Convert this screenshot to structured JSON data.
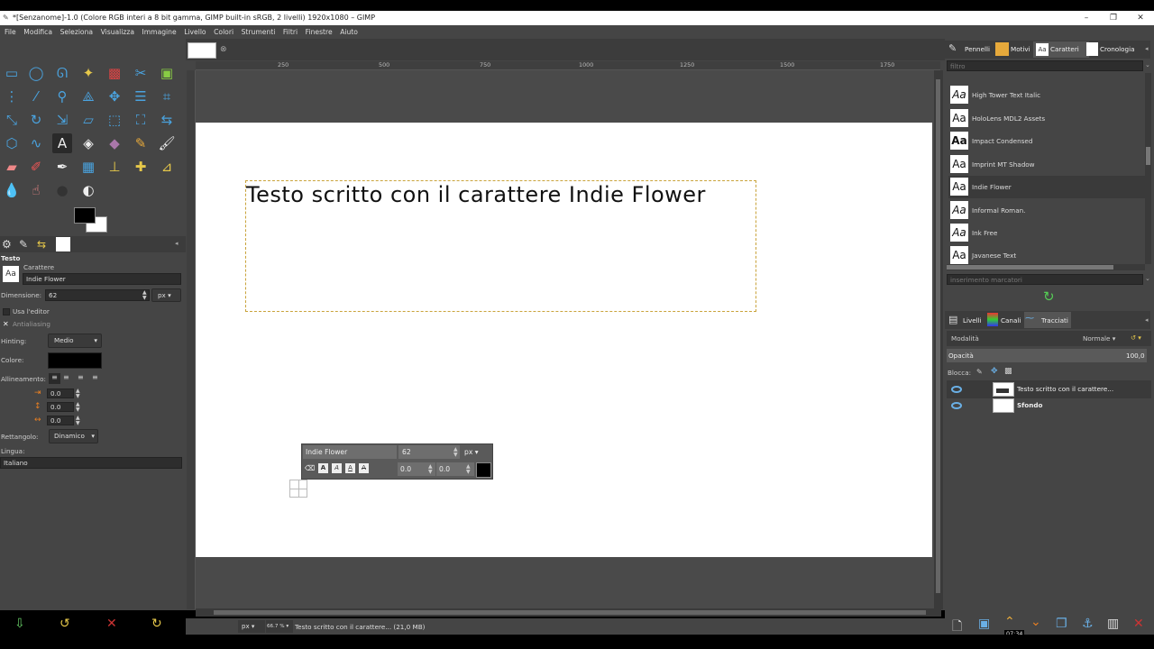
{
  "window": {
    "title": "*[Senzanome]-1.0 (Colore RGB interi a 8 bit gamma, GIMP built-in sRGB, 2 livelli) 1920x1080 – GIMP"
  },
  "menu": [
    "File",
    "Modifica",
    "Seleziona",
    "Visualizza",
    "Immagine",
    "Livello",
    "Colori",
    "Strumenti",
    "Filtri",
    "Finestre",
    "Aiuto"
  ],
  "ruler": {
    "ticks": [
      "250",
      "500",
      "750",
      "1000",
      "1250",
      "1500",
      "1750"
    ]
  },
  "canvas": {
    "text": "Testo scritto con il carattere Indie Flower"
  },
  "tool_options": {
    "title": "Testo",
    "font_label": "Carattere",
    "font_value": "Indie Flower",
    "size_label": "Dimensione:",
    "size_value": "62",
    "size_unit": "px",
    "use_editor": "Usa l'editor",
    "antialiasing": "Antialiasing",
    "hinting_label": "Hinting:",
    "hinting_value": "Medio",
    "color_label": "Colore:",
    "align_label": "Allineamento:",
    "indent_value": "0.0",
    "line_spacing_value": "0.0",
    "letter_spacing_value": "0.0",
    "box_label": "Rettangolo:",
    "box_value": "Dinamico",
    "lang_label": "Lingua:",
    "lang_value": "Italiano"
  },
  "on_canvas_editor": {
    "font": "Indie Flower",
    "size": "62",
    "unit": "px",
    "baseline": "0.0",
    "kerning": "0.0"
  },
  "status": {
    "unit": "px",
    "zoom": "66.7 %",
    "message": "Testo scritto con il carattere... (21,0 MB)"
  },
  "right_dock": {
    "tabs": [
      "Pennelli",
      "Motivi",
      "Caratteri",
      "Cronologia"
    ],
    "filter_placeholder": "filtro",
    "fonts": [
      {
        "sample": "Aa",
        "name": "High Tower Text Italic"
      },
      {
        "sample": "Aa",
        "name": "HoloLens MDL2 Assets"
      },
      {
        "sample": "Aa",
        "name": "Impact Condensed"
      },
      {
        "sample": "Aa",
        "name": "Imprint MT Shadow"
      },
      {
        "sample": "Aa",
        "name": "Indie Flower"
      },
      {
        "sample": "Aa",
        "name": "Informal Roman."
      },
      {
        "sample": "Aa",
        "name": "Ink Free"
      },
      {
        "sample": "Aa",
        "name": "Javanese Text"
      }
    ],
    "tag_placeholder": "inserimento marcatori",
    "layer_tabs": [
      "Livelli",
      "Canali",
      "Tracciati"
    ],
    "mode_label": "Modalità",
    "mode_value": "Normale",
    "opacity_label": "Opacità",
    "opacity_value": "100,0",
    "lock_label": "Blocca:",
    "layers": [
      {
        "name": "Testo scritto con il carattere..."
      },
      {
        "name": "Sfondo"
      }
    ]
  },
  "time_overlay": "07:34"
}
